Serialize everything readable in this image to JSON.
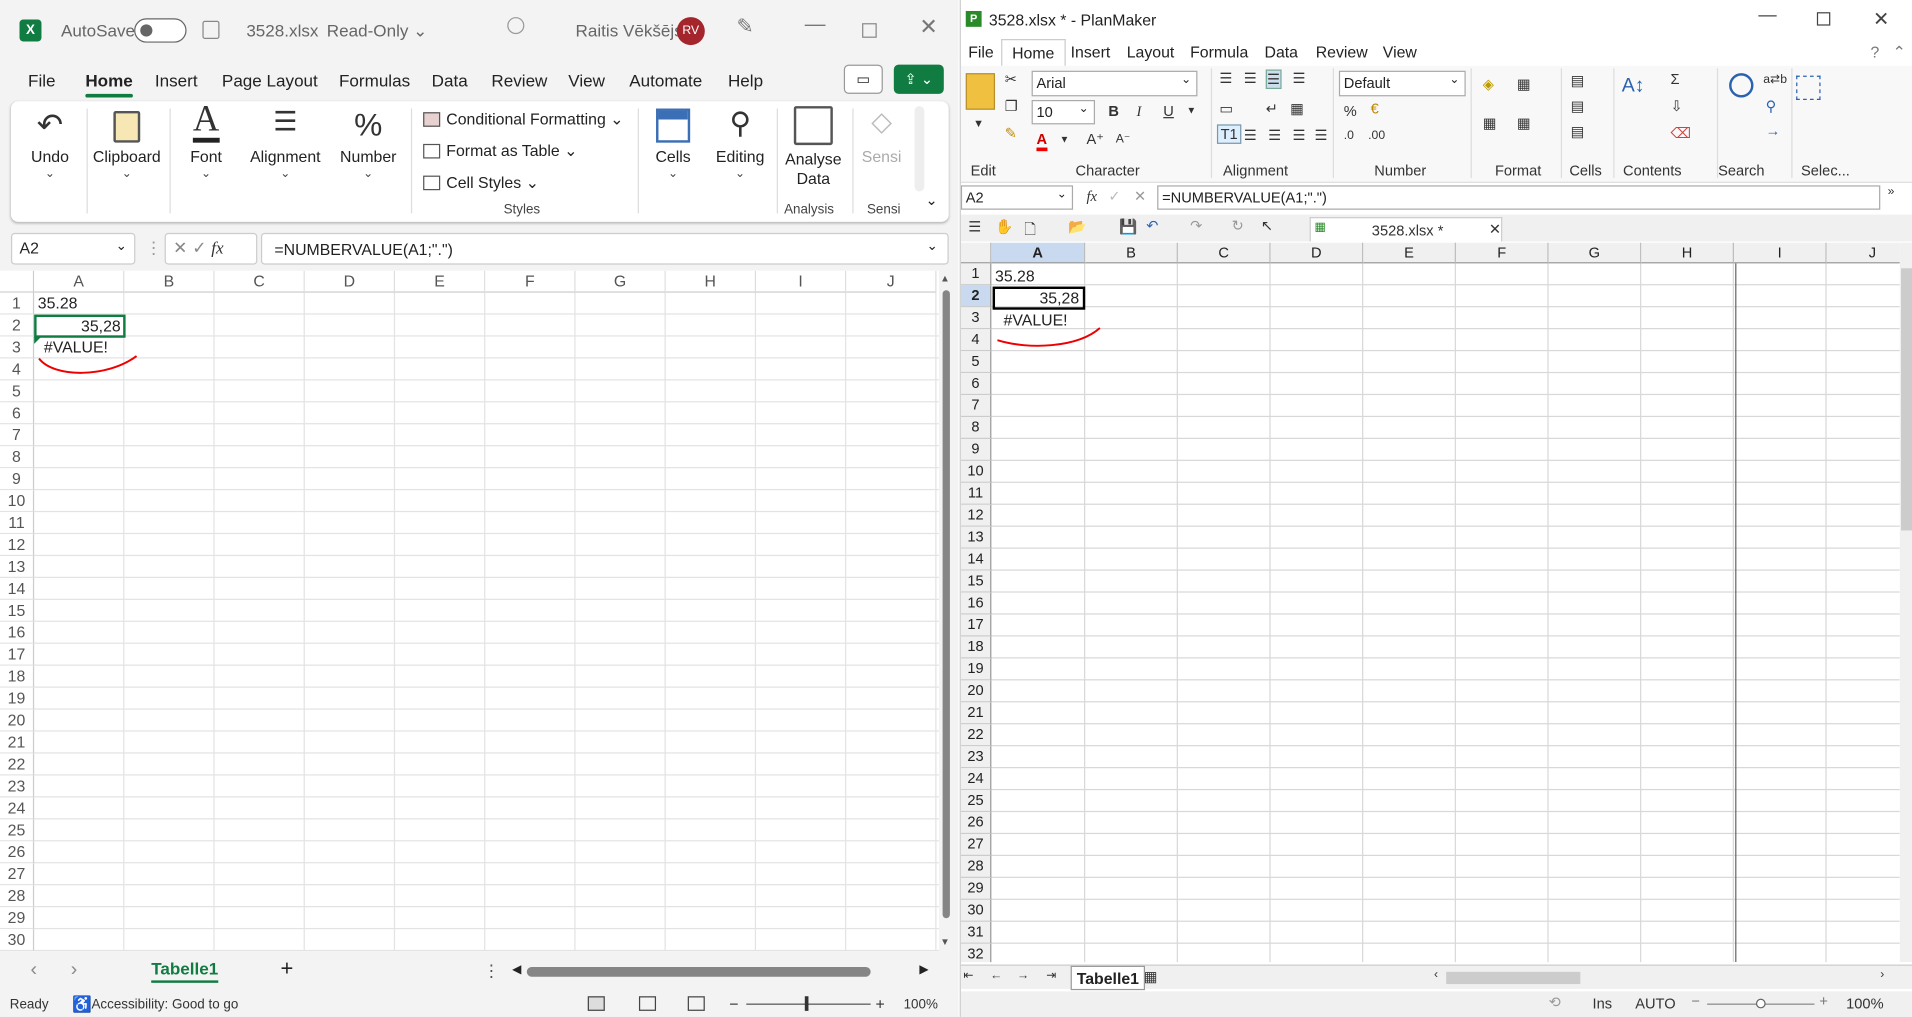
{
  "excel": {
    "title": {
      "autosave": "AutoSave",
      "filename": "3528.xlsx",
      "mode": "Read-Only ⌄",
      "user": "Raitis Vēkšējs",
      "initials": "RV"
    },
    "tabs": [
      "File",
      "Home",
      "Insert",
      "Page Layout",
      "Formulas",
      "Data",
      "Review",
      "View",
      "Automate",
      "Help"
    ],
    "ribbon": {
      "undo": "Undo",
      "clipboard": "Clipboard",
      "font": "Font",
      "alignment": "Alignment",
      "number": "Number",
      "cond_fmt": "Conditional Formatting ⌄",
      "fmt_table": "Format as Table ⌄",
      "cell_styles": "Cell Styles ⌄",
      "styles": "Styles",
      "cells": "Cells",
      "editing": "Editing",
      "analyse1": "Analyse",
      "analyse2": "Data",
      "analysis": "Analysis",
      "sensi": "Sensi",
      "sensi_group": "Sensi"
    },
    "namebox": "A2",
    "fx": "fx",
    "formula": "=NUMBERVALUE(A1;\".\")",
    "columns": [
      "A",
      "B",
      "C",
      "D",
      "E",
      "F",
      "G",
      "H",
      "I",
      "J"
    ],
    "cells": {
      "a1": "35.28",
      "a2": "35,28",
      "a3": "#VALUE!"
    },
    "sheet": "Tabelle1",
    "add": "+",
    "status": {
      "ready": "Ready",
      "access": "Accessibility: Good to go",
      "zoom": "100%"
    }
  },
  "planmaker": {
    "title": "3528.xlsx * - PlanMaker",
    "menu": [
      "File",
      "Home",
      "Insert",
      "Layout",
      "Formula",
      "Data",
      "Review",
      "View"
    ],
    "font": "Arial",
    "size": "10",
    "numfmt": "Default",
    "groups": [
      "Edit",
      "Character",
      "Alignment",
      "Number",
      "Format",
      "Cells",
      "Contents",
      "Search",
      "Selec..."
    ],
    "namebox": "A2",
    "formula": "=NUMBERVALUE(A1;\".\")",
    "doc_tab": "3528.xlsx *",
    "columns": [
      "A",
      "B",
      "C",
      "D",
      "E",
      "F",
      "G",
      "H",
      "I",
      "J"
    ],
    "cells": {
      "a1": "35.28",
      "a2": "35,28",
      "a3": "#VALUE!"
    },
    "sheet": "Tabelle1",
    "status": {
      "ins": "Ins",
      "auto": "AUTO",
      "zoom": "100%"
    }
  }
}
